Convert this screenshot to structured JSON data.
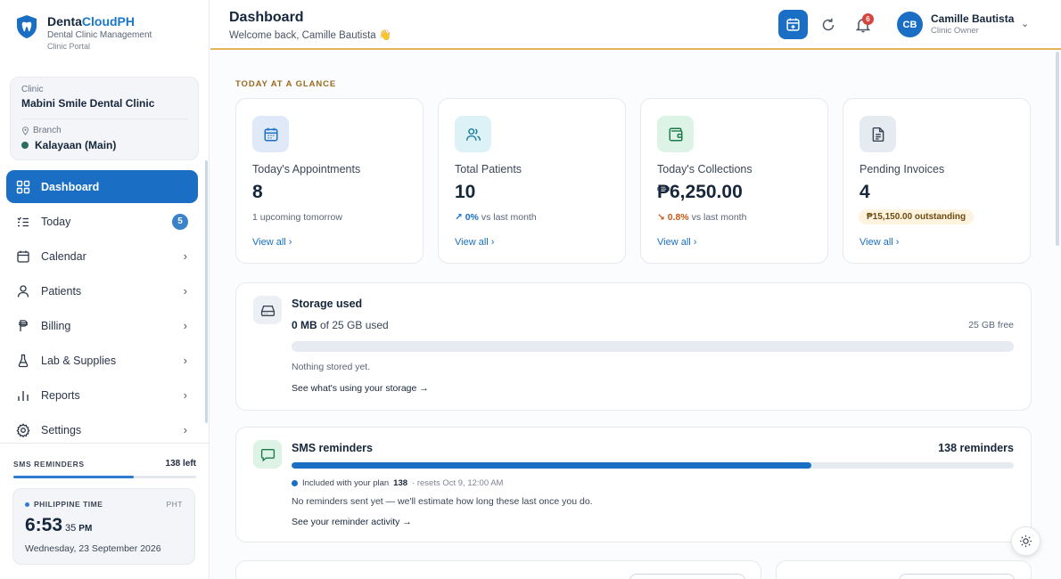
{
  "brand": {
    "name_part1": "Denta",
    "name_part2": "CloudPH",
    "subtitle": "Dental Clinic Management",
    "portal": "Clinic Portal"
  },
  "clinic": {
    "label": "Clinic",
    "name": "Mabini Smile Dental Clinic",
    "branch_label": "Branch",
    "branch": "Kalayaan (Main)"
  },
  "nav": [
    {
      "label": "Dashboard",
      "icon": "grid-icon",
      "active": true
    },
    {
      "label": "Today",
      "icon": "list-icon",
      "badge": "5"
    },
    {
      "label": "Calendar",
      "icon": "calendar-icon"
    },
    {
      "label": "Patients",
      "icon": "user-icon"
    },
    {
      "label": "Billing",
      "icon": "peso-icon"
    },
    {
      "label": "Lab & Supplies",
      "icon": "flask-icon"
    },
    {
      "label": "Reports",
      "icon": "bar-chart-icon"
    },
    {
      "label": "Settings",
      "icon": "gear-icon"
    }
  ],
  "sms_sidebar": {
    "label": "SMS REMINDERS",
    "left": "138 left",
    "fill_fraction": 0.66
  },
  "time": {
    "label": "PHILIPPINE TIME",
    "zone": "PHT",
    "time": "6:53",
    "seconds": "35",
    "ampm": "PM",
    "date": "Wednesday, 23 September 2026"
  },
  "header": {
    "title": "Dashboard",
    "welcome": "Welcome back, Camille Bautista 👋",
    "notifications": "6",
    "avatar_initials": "CB",
    "user_name": "Camille Bautista",
    "user_role": "Clinic Owner"
  },
  "glance_label": "TODAY AT A GLANCE",
  "stats": [
    {
      "label": "Today's Appointments",
      "value": "8",
      "sub": "1 upcoming tomorrow",
      "link": "View all ›",
      "icon": "calendar-icon",
      "icon_bg": "#dfe9f7",
      "icon_color": "#1a6fc4"
    },
    {
      "label": "Total Patients",
      "value": "10",
      "trend": "↗ 0%",
      "trend_text": " vs last month",
      "link": "View all ›",
      "icon": "users-icon",
      "icon_bg": "#dcf2f7",
      "icon_color": "#1a7ea0"
    },
    {
      "label": "Today's Collections",
      "value": "₱6,250.00",
      "trend": "↘ 0.8%",
      "trend_text": " vs last month",
      "link": "View all ›",
      "icon": "wallet-icon",
      "icon_bg": "#dcf3e6",
      "icon_color": "#1e7a4a"
    },
    {
      "label": "Pending Invoices",
      "value": "4",
      "pill": "₱15,150.00 outstanding",
      "link": "View all ›",
      "icon": "document-icon",
      "icon_bg": "#e6ebf2",
      "icon_color": "#3b4656"
    }
  ],
  "storage": {
    "title": "Storage used",
    "used_value": "0 MB",
    "used_rest": " of 25 GB used",
    "free": "25 GB free",
    "fill_fraction": 0,
    "note": "Nothing stored yet.",
    "link": "See what's using your storage →"
  },
  "sms": {
    "title": "SMS reminders",
    "count": "138 reminders",
    "fill_fraction": 0.72,
    "included": "Included with your plan",
    "included_value": "138",
    "resets": "· resets Oct 9, 12:00 AM",
    "note": "No reminders sent yet — we'll estimate how long these last once you do.",
    "link": "See your reminder activity →"
  }
}
